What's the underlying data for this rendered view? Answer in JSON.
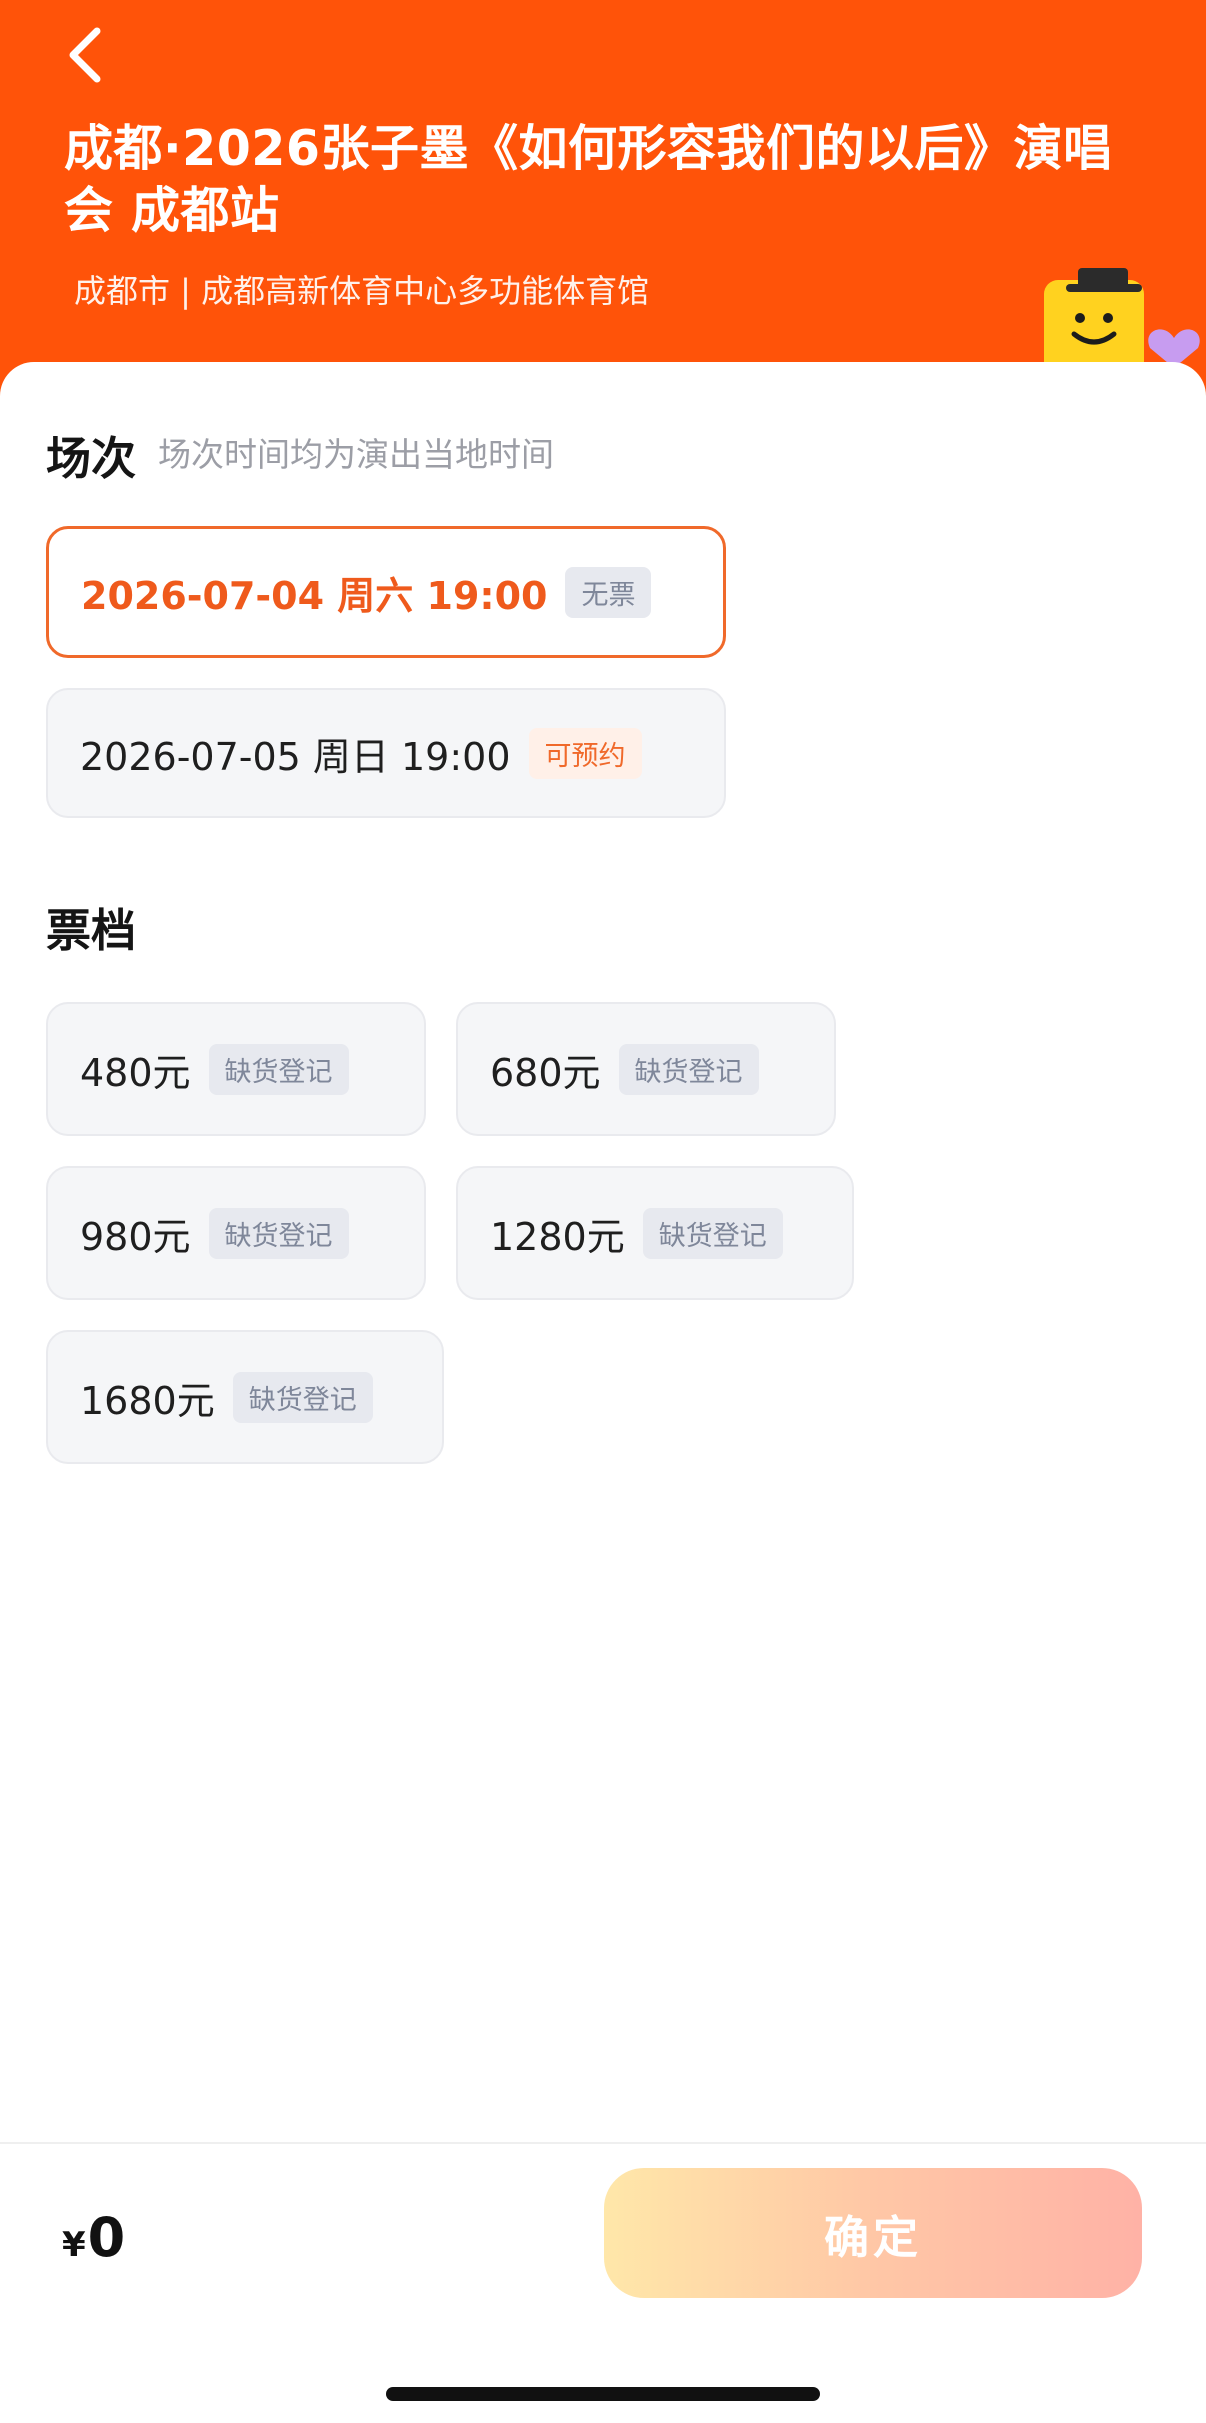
{
  "header": {
    "title": "成都·2026张子墨《如何形容我们的以后》演唱会 成都站",
    "subtitle": "成都市 | 成都高新体育中心多功能体育馆"
  },
  "sessions": {
    "label": "场次",
    "hint": "场次时间均为演出当地时间",
    "items": [
      {
        "text": "2026-07-04  周六 19:00",
        "tag": "无票",
        "selected": true
      },
      {
        "text": "2026-07-05 周日 19:00",
        "tag": "可预约",
        "selected": false
      }
    ]
  },
  "tiers": {
    "label": "票档",
    "items": [
      {
        "price": "480元",
        "tag": "缺货登记"
      },
      {
        "price": "680元",
        "tag": "缺货登记"
      },
      {
        "price": "980元",
        "tag": "缺货登记"
      },
      {
        "price": "1280元",
        "tag": "缺货登记"
      },
      {
        "price": "1680元",
        "tag": "缺货登记"
      }
    ]
  },
  "footer": {
    "currency": "¥",
    "amount": "0",
    "confirm_label": "确定"
  },
  "colors": {
    "brand": "#ff5309",
    "selected_border": "#f0692a",
    "chip_bg": "#f5f6f8"
  },
  "icons": {
    "back": "chevron-left-icon",
    "mascot": "mascot-illustration"
  }
}
